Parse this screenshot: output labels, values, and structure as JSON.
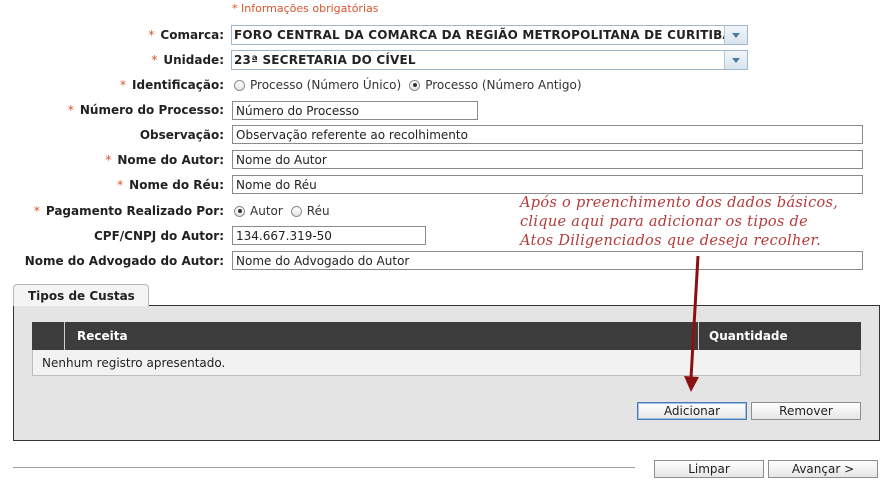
{
  "required_note": "* Informações obrigatórias",
  "form": {
    "comarca": {
      "label": "Comarca:",
      "value": "FORO CENTRAL DA COMARCA DA REGIÃO METROPOLITANA DE CURITIBA"
    },
    "unidade": {
      "label": "Unidade:",
      "value": "23ª SECRETARIA DO CÍVEL"
    },
    "identificacao": {
      "label": "Identificação:",
      "options": [
        "Processo (Número Único)",
        "Processo (Número Antigo)"
      ],
      "selected": "Processo (Número Antigo)"
    },
    "numero_processo": {
      "label": "Número do Processo:",
      "value": "Número do Processo"
    },
    "observacao": {
      "label": "Observação:",
      "value": "Observação referente ao recolhimento"
    },
    "nome_autor": {
      "label": "Nome do Autor:",
      "value": "Nome do Autor"
    },
    "nome_reu": {
      "label": "Nome do Réu:",
      "value": "Nome do Réu"
    },
    "pagamento": {
      "label": "Pagamento Realizado Por:",
      "options": [
        "Autor",
        "Réu"
      ],
      "selected": "Autor"
    },
    "cpf_cnpj": {
      "label": "CPF/CNPJ do Autor:",
      "value": "134.667.319-50"
    },
    "nome_advogado": {
      "label": "Nome do Advogado do Autor:",
      "value": "Nome do Advogado do Autor"
    }
  },
  "annotation": {
    "lines": [
      "Após o preenchimento dos dados básicos,",
      "clique aqui para adicionar os tipos de",
      "Atos Diligenciados que deseja recolher."
    ],
    "color": "#b63a3a"
  },
  "custas": {
    "tab_label": "Tipos de Custas",
    "columns": [
      "Receita",
      "Quantidade"
    ],
    "empty_message": "Nenhum registro apresentado.",
    "add_button": "Adicionar",
    "remove_button": "Remover"
  },
  "footer": {
    "clear_button": "Limpar",
    "next_button": "Avançar >"
  },
  "colors": {
    "required": "#d9532c",
    "grid_header": "#3c3c3c",
    "panel": "#e4e4e4"
  }
}
